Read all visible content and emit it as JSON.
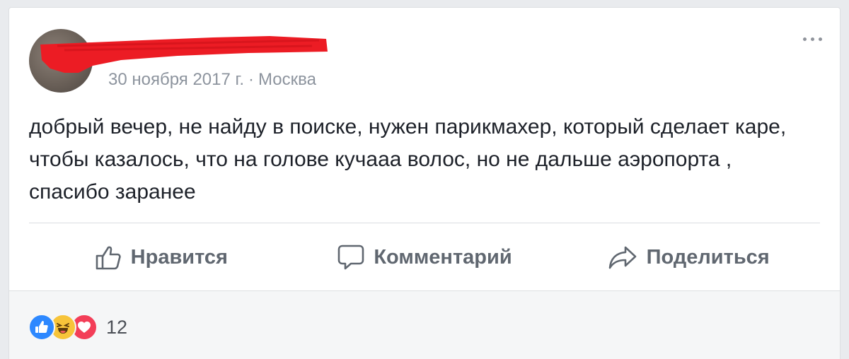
{
  "post": {
    "date": "30 ноября 2017 г.",
    "separator": "·",
    "location": "Москва",
    "text": "добрый вечер, не найду в поиске, нужен парикмахер, который сделает каре, чтобы казалось, что на голове кучааа волос, но не дальше аэропорта , спасибо заранее"
  },
  "actions": {
    "like_label": "Нравится",
    "comment_label": "Комментарий",
    "share_label": "Поделиться"
  },
  "reactions": {
    "icons": [
      "like-icon",
      "haha-icon",
      "love-icon"
    ],
    "count": "12"
  },
  "colors": {
    "redaction": "#ec1c24",
    "like": "#2d88ff",
    "haha": "#f7c43a",
    "love": "#f33e58",
    "action_text": "#606770",
    "meta_text": "#8d949e"
  }
}
